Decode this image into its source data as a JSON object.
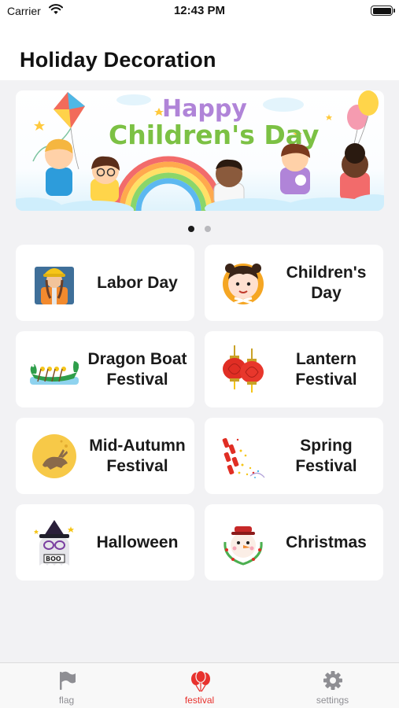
{
  "status_bar": {
    "carrier": "Carrier",
    "time": "12:43 PM"
  },
  "header": {
    "title": "Holiday Decoration"
  },
  "banner": {
    "line1": "Happy",
    "line2": "Children's Day",
    "page_index": 1,
    "page_count": 2
  },
  "festivals": [
    {
      "label": "Labor Day",
      "icon": "construction-worker-icon"
    },
    {
      "label": "Children's Day",
      "icon": "child-face-icon"
    },
    {
      "label": "Dragon Boat Festival",
      "icon": "dragon-boat-icon"
    },
    {
      "label": "Lantern Festival",
      "icon": "red-lantern-icon"
    },
    {
      "label": "Mid-Autumn Festival",
      "icon": "moon-rabbit-icon"
    },
    {
      "label": "Spring Festival",
      "icon": "firecracker-icon"
    },
    {
      "label": "Halloween",
      "icon": "witch-ghost-icon"
    },
    {
      "label": "Christmas",
      "icon": "snowman-wreath-icon"
    }
  ],
  "tab_bar": {
    "tabs": [
      {
        "label": "flag",
        "icon": "flag-icon",
        "active": false
      },
      {
        "label": "festival",
        "icon": "balloons-icon",
        "active": true
      },
      {
        "label": "settings",
        "icon": "gear-icon",
        "active": false
      }
    ]
  },
  "colors": {
    "accent": "#e8322e",
    "inactive": "#8e8e93",
    "background": "#f2f2f4"
  }
}
